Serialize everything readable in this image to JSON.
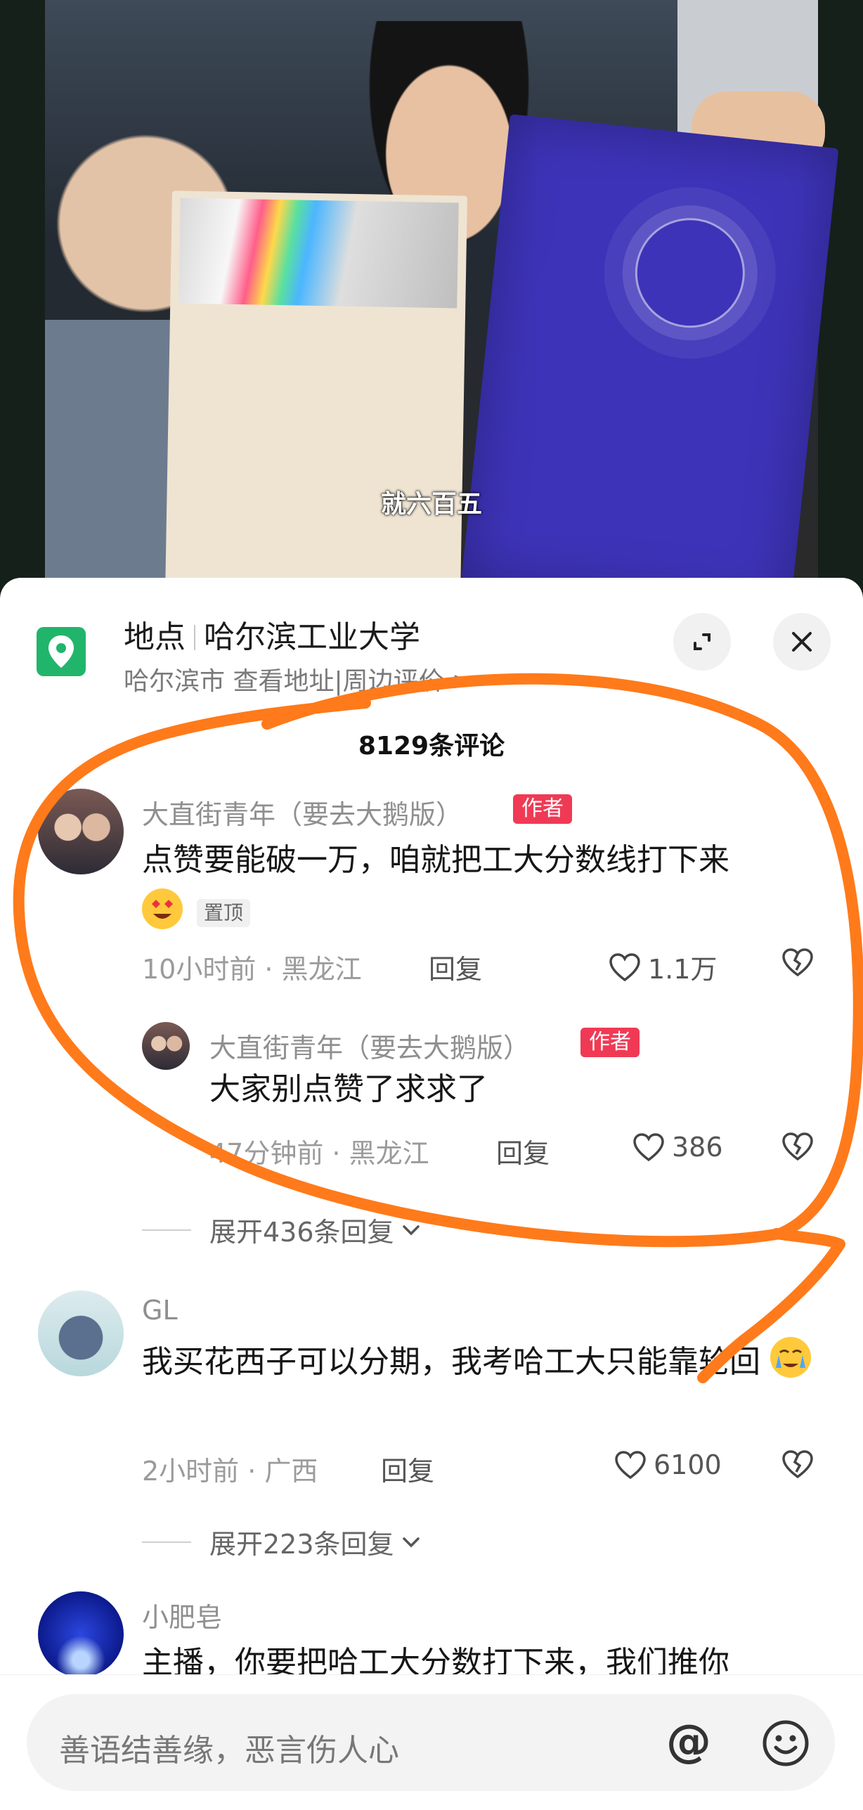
{
  "video": {
    "subtitle": "就六百五"
  },
  "location": {
    "label": "地点",
    "place": "哈尔滨工业大学",
    "city_line": "哈尔滨市  查看地址|周边评价 >",
    "icon": "location-pin-icon"
  },
  "header_buttons": {
    "expand_icon": "expand-icon",
    "close_icon": "close-icon"
  },
  "comment_count": "8129条评论",
  "comments": [
    {
      "user": "大直街青年（要去大鹅版）",
      "badge": "作者",
      "text": "点赞要能破一万，咱就把工大分数线打下来",
      "pin": "置顶",
      "meta": "10小时前 · 黑龙江",
      "reply": "回复",
      "likes": "1.1万",
      "replies": [
        {
          "user": "大直街青年（要去大鹅版）",
          "badge": "作者",
          "text": "大家别点赞了求求了",
          "meta": "47分钟前 · 黑龙江",
          "reply": "回复",
          "likes": "386"
        }
      ],
      "expand": "展开436条回复"
    },
    {
      "user": "GL",
      "text": "我买花西子可以分期，我考哈工大只能靠轮回",
      "meta": "2小时前 · 广西",
      "reply": "回复",
      "likes": "6100",
      "expand": "展开223条回复"
    },
    {
      "user": "小肥皂",
      "text": "主播，你要把哈工大分数打下来，我们推你"
    }
  ],
  "input": {
    "placeholder": "善语结善缘，恶言伤人心",
    "at_symbol": "@",
    "emoji_icon": "smile-icon"
  },
  "colors": {
    "author_badge": "#f03a55",
    "location_icon": "#21b56b",
    "annotation": "#ff7a1a"
  }
}
